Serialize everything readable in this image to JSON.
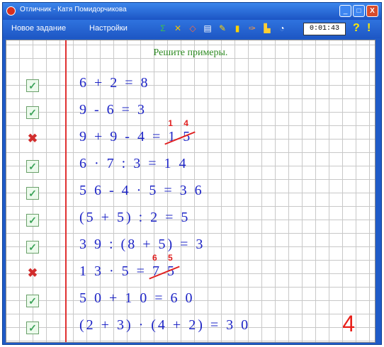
{
  "window": {
    "title": "Отличник - Катя Помидорчикова",
    "buttons": [
      "_",
      "□",
      "X"
    ]
  },
  "toolbar": {
    "new_task": "Новое задание",
    "settings": "Настройки",
    "timer": "0:01:43",
    "help": "?",
    "alert": "!",
    "icons": [
      "sigma-icon",
      "tools-icon",
      "eraser-icon",
      "calendar-icon",
      "pencil-icon",
      "book-icon",
      "brush-icon",
      "chart-icon",
      "clock-icon"
    ]
  },
  "task": {
    "instruction": "Решите примеры.",
    "score": "4",
    "colors": {
      "expression": "#1d24c6",
      "error": "#e02020",
      "check": "#3da35a",
      "title": "#2e8b22"
    },
    "problems": [
      {
        "status": "correct",
        "mark": "✓",
        "expression": "6 + 2 = 8"
      },
      {
        "status": "correct",
        "mark": "✓",
        "expression": "9 - 6 = 3"
      },
      {
        "status": "wrong",
        "mark": "✖",
        "expression": "9 + 9 - 4 = ",
        "answer": "1 5",
        "correction": "1 4"
      },
      {
        "status": "correct",
        "mark": "✓",
        "expression": "6 · 7 : 3 = 1 4"
      },
      {
        "status": "correct",
        "mark": "✓",
        "expression": "5 6 - 4 · 5 = 3 6"
      },
      {
        "status": "correct",
        "mark": "✓",
        "expression": "(5 + 5) : 2 = 5"
      },
      {
        "status": "correct",
        "mark": "✓",
        "expression": "3 9 : (8 + 5) = 3"
      },
      {
        "status": "wrong",
        "mark": "✖",
        "expression": "1 3 · 5 = ",
        "answer": "7 5",
        "correction": "6 5"
      },
      {
        "status": "correct",
        "mark": "✓",
        "expression": "5 0 + 1 0 = 6 0"
      },
      {
        "status": "correct",
        "mark": "✓",
        "expression": "(2 + 3) · (4 + 2) = 3 0"
      }
    ]
  }
}
